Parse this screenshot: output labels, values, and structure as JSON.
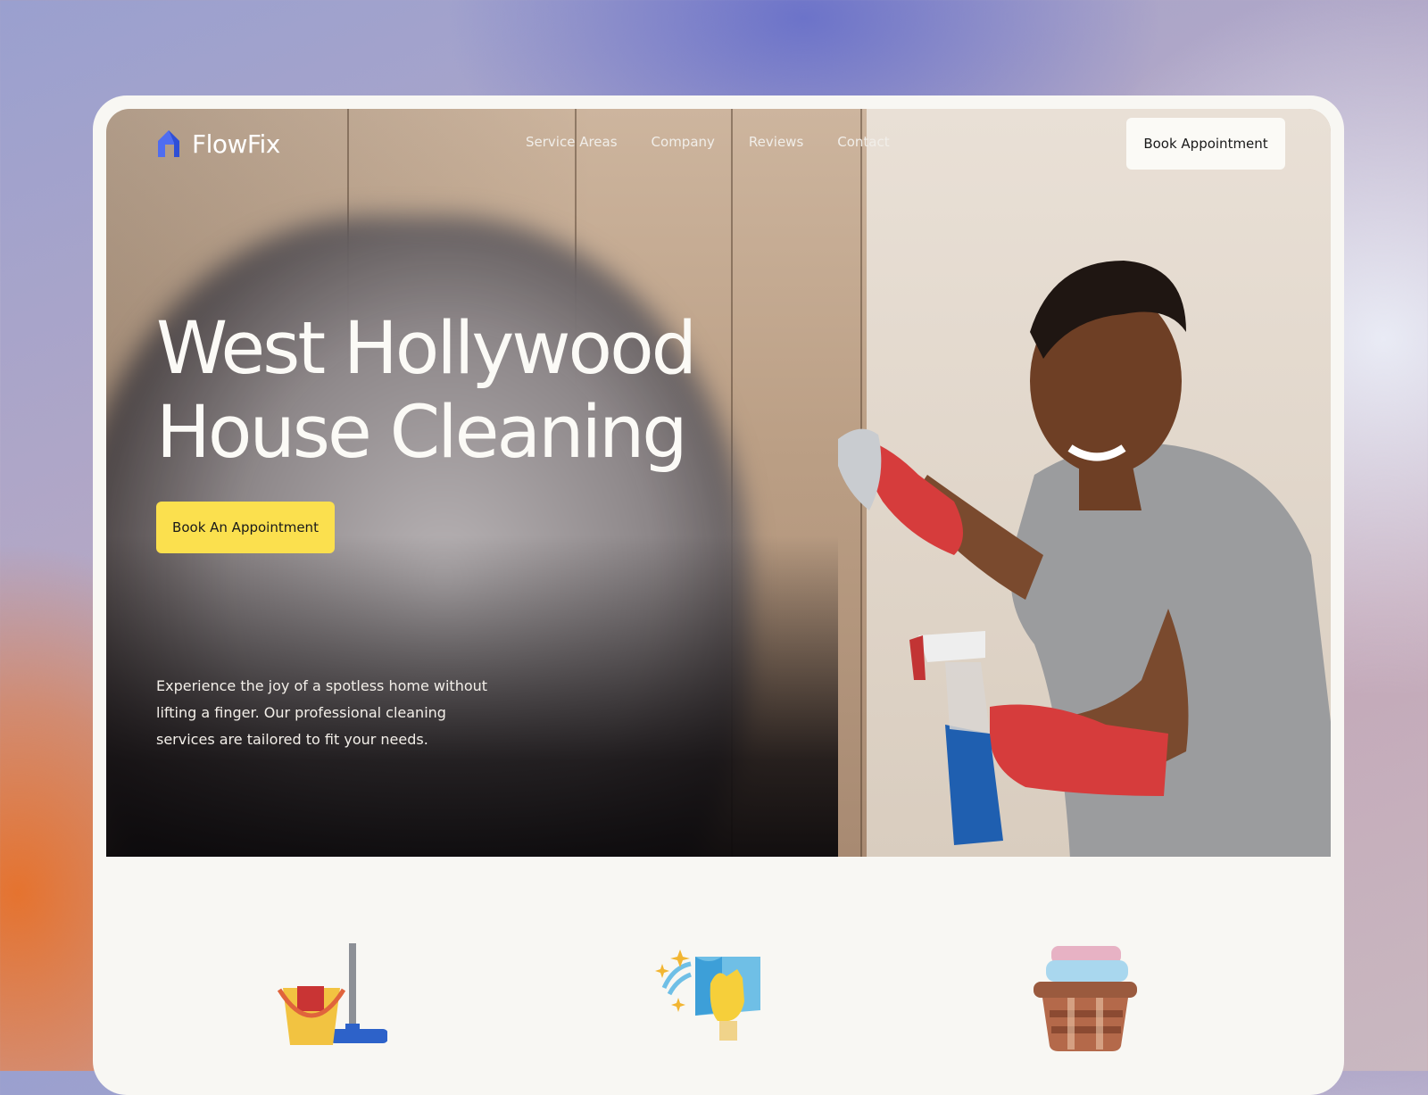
{
  "brand": {
    "name": "FlowFix",
    "accent": "#4f6df0"
  },
  "nav": {
    "items": [
      {
        "label": "Service Areas"
      },
      {
        "label": "Company"
      },
      {
        "label": "Reviews"
      },
      {
        "label": "Contact"
      }
    ]
  },
  "header": {
    "book_label": "Book Appointment"
  },
  "hero": {
    "headline_line1": "West Hollywood",
    "headline_line2": "House Cleaning",
    "cta_label": "Book An Appointment",
    "cta_color": "#fbe04e",
    "description": "Experience the joy of a spotless home without lifting a finger. Our professional cleaning services are tailored to fit your needs."
  },
  "services": {
    "icons": [
      "bucket-mop-icon",
      "window-cleaning-icon",
      "laundry-basket-icon"
    ]
  }
}
